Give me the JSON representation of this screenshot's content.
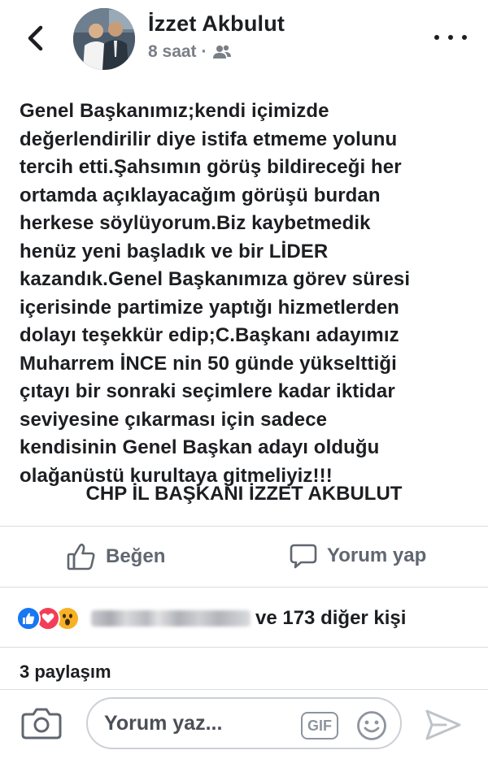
{
  "header": {
    "author": "İzzet Akbulut",
    "time": "8 saat",
    "separator": "·",
    "audience_icon": "friends-icon"
  },
  "post": {
    "text": "Genel Başkanımız;kendi içimizde\ndeğerlendirilir diye istifa etmeme yolunu\ntercih etti.Şahsımın görüş bildireceği her\nortamda açıklayacağım görüşü burdan\nherkese söylüyorum.Biz kaybetmedik\nhenüz yeni başladık ve bir LİDER\nkazandık.Genel Başkanımıza görev süresi\niçerisinde partimize yaptığı hizmetlerden\ndolayı teşekkür edip;C.Başkanı adayımız\nMuharrem İNCE nin 50 günde yükselttiği\nçıtayı bir sonraki seçimlere kadar iktidar\nseviyesine çıkarması için sadece\nkendisinin Genel Başkan adayı olduğu\nolağanüstü kurultaya gitmeliyiz!!!",
    "signature": "CHP İL BAŞKANI İZZET AKBULUT"
  },
  "actions": {
    "like_label": "Beğen",
    "comment_label": "Yorum yap"
  },
  "reactions": {
    "icons": [
      "like-reaction-icon",
      "love-reaction-icon",
      "wow-reaction-icon"
    ],
    "summary": "ve 173 diğer kişi"
  },
  "shares": {
    "label": "3 paylaşım"
  },
  "comment_bar": {
    "placeholder": "Yorum yaz...",
    "gif_label": "GIF"
  },
  "colors": {
    "text": "#1c1e21",
    "secondary": "#606770",
    "like_blue": "#1877f2",
    "love_red": "#f33e58",
    "wow_yellow": "#f7b125"
  }
}
